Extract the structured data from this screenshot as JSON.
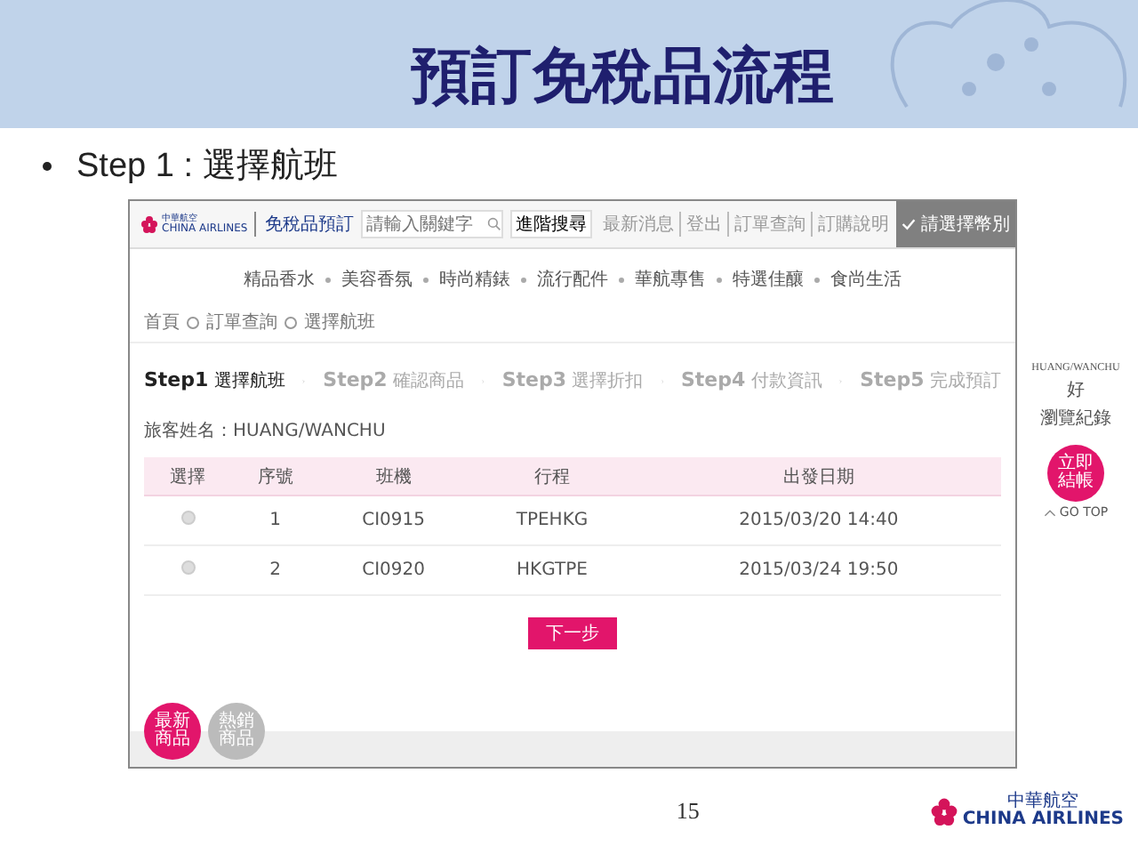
{
  "slide": {
    "title": "預訂免稅品流程",
    "bullet": "Step 1 : 選擇航班",
    "page_number": "15",
    "footer_logo": {
      "chinese": "中華航空",
      "english": "CHINA AIRLINES"
    }
  },
  "site": {
    "logo": {
      "chinese": "中華航空",
      "english": "CHINA AIRLINES"
    },
    "section": "免稅品預訂",
    "search": {
      "placeholder": "請輸入關鍵字",
      "button": "進階搜尋"
    },
    "top_links": [
      "最新消息",
      "登出",
      "訂單查詢",
      "訂購說明"
    ],
    "currency_button": "請選擇幣別",
    "nav": [
      "精品香水",
      "美容香氛",
      "時尚精錶",
      "流行配件",
      "華航專售",
      "特選佳釀",
      "食尚生活"
    ],
    "breadcrumb": [
      "首頁",
      "訂單查詢",
      "選擇航班"
    ],
    "steps": [
      {
        "step": "Step1",
        "label": "選擇航班",
        "selected": true
      },
      {
        "step": "Step2",
        "label": "確認商品",
        "selected": false
      },
      {
        "step": "Step3",
        "label": "選擇折扣",
        "selected": false
      },
      {
        "step": "Step4",
        "label": "付款資訊",
        "selected": false
      },
      {
        "step": "Step5",
        "label": "完成預訂",
        "selected": false
      }
    ],
    "passenger": "旅客姓名：HUANG/WANCHU",
    "table": {
      "columns": [
        "選擇",
        "序號",
        "班機",
        "行程",
        "出發日期"
      ],
      "rows": [
        {
          "selected": false,
          "cells": [
            "",
            "1",
            "CI0915",
            "TPEHKG",
            "2015/03/20 14:40"
          ]
        },
        {
          "selected": false,
          "cells": [
            "",
            "2",
            "CI0920",
            "HKGTPE",
            "2015/03/24 19:50"
          ]
        }
      ]
    },
    "next_button": "下一步",
    "bottom_buttons": [
      {
        "label": "最新商品",
        "selected": true
      },
      {
        "label": "熱銷商品",
        "selected": false
      }
    ],
    "sidebar": {
      "user": "HUANG/WANCHU",
      "greeting": "好",
      "history": "瀏覽紀錄",
      "checkout": "立即結帳",
      "go_top": "GO TOP"
    }
  }
}
